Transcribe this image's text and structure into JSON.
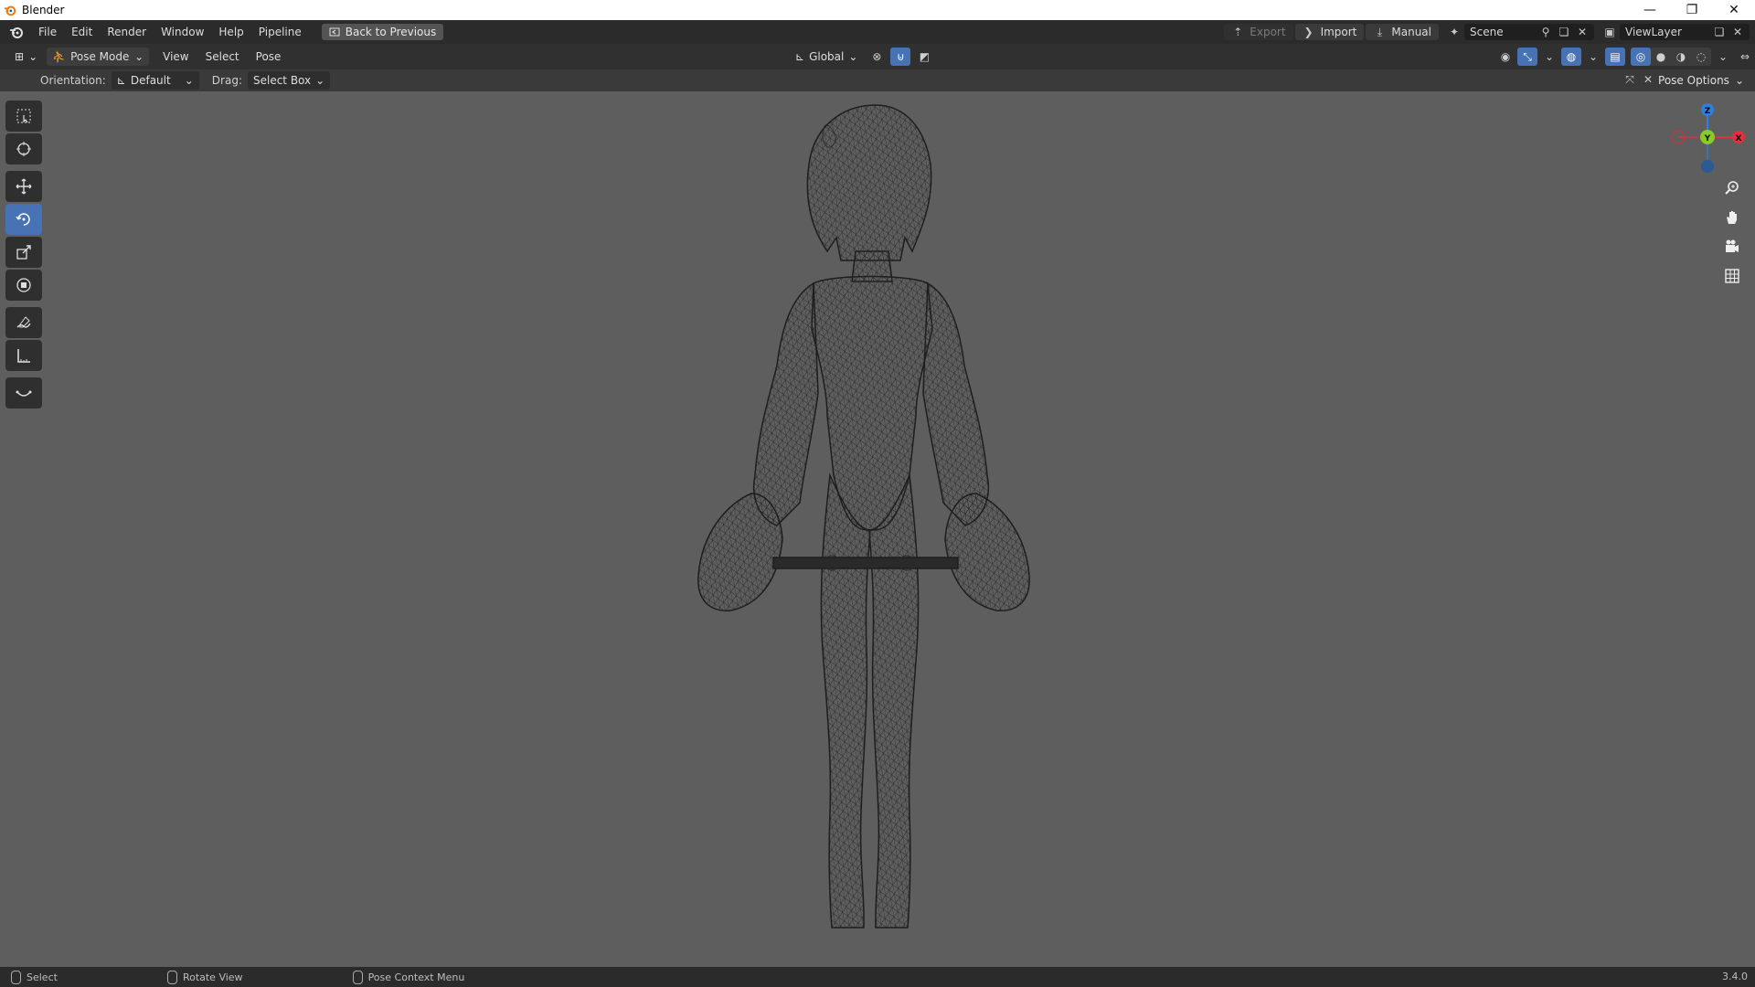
{
  "window": {
    "title": "Blender",
    "minimize_glyph": "—",
    "restore_glyph": "❐",
    "close_glyph": "✕"
  },
  "menubar": {
    "items": [
      "File",
      "Edit",
      "Render",
      "Window",
      "Help",
      "Pipeline"
    ],
    "back_button": "Back to Previous",
    "export": "Export",
    "import": "Import",
    "manual": "Manual",
    "scene": "Scene",
    "view_layer": "ViewLayer"
  },
  "viewport_header": {
    "mode": "Pose Mode",
    "menus": [
      "View",
      "Select",
      "Pose"
    ],
    "transform_orientation": "Global"
  },
  "tool_settings": {
    "orientation_label": "Orientation:",
    "orientation_value": "Default",
    "drag_label": "Drag:",
    "drag_value": "Select Box",
    "pose_options": "Pose Options"
  },
  "gizmo": {
    "z": "Z",
    "y": "Y",
    "x": "X"
  },
  "statusbar": {
    "select": "Select",
    "rotate_view": "Rotate View",
    "context_menu": "Pose Context Menu",
    "version": "3.4.0"
  },
  "colors": {
    "accent": "#4772b3",
    "axis_x": "#e0313f",
    "axis_y": "#8ac926",
    "axis_z": "#2f7fe0"
  }
}
